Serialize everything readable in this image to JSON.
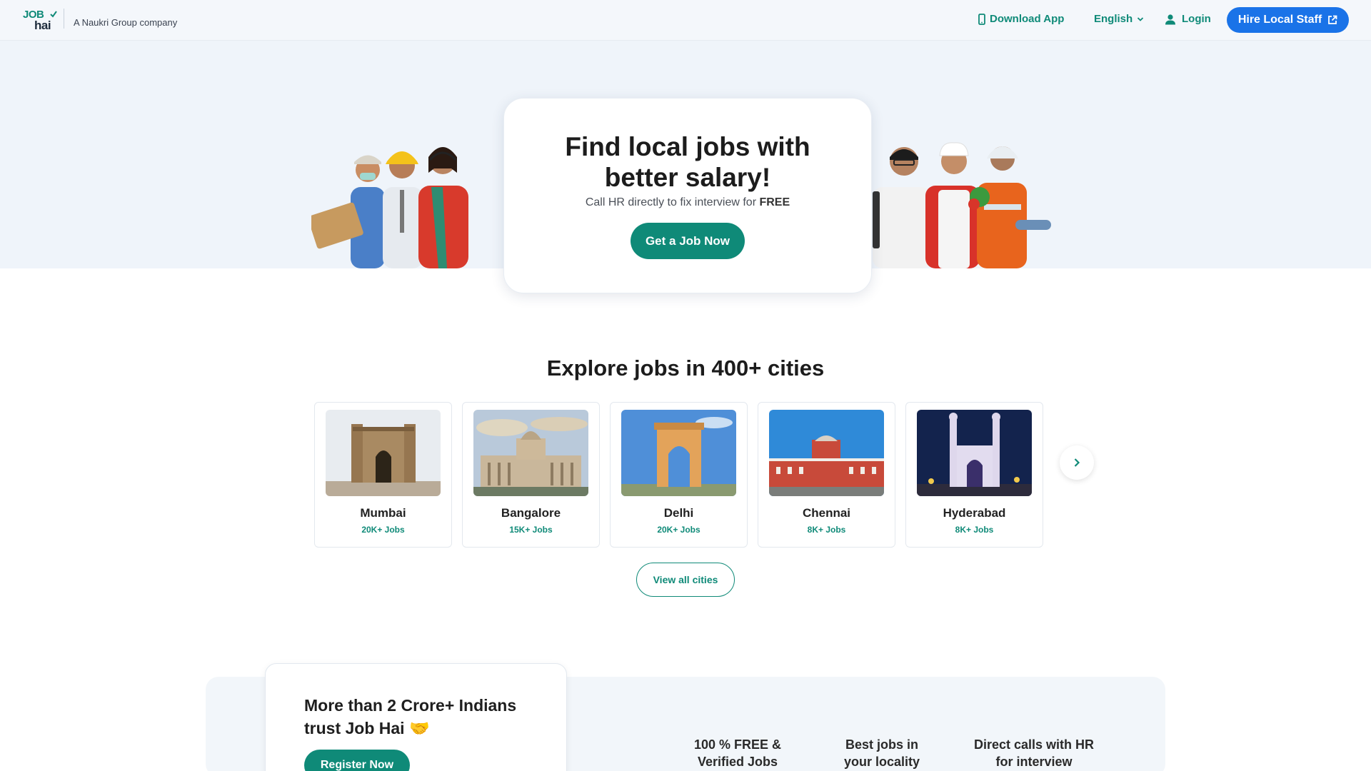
{
  "header": {
    "logo_top": "JOB",
    "logo_bottom": "hai",
    "tagline": "A Naukri Group company",
    "download_label": "Download App",
    "language_label": "English",
    "login_label": "Login",
    "hire_label": "Hire Local Staff"
  },
  "hero": {
    "title_line1": "Find local jobs with",
    "title_line2": "better salary!",
    "subtitle_prefix": "Call HR directly to fix interview for ",
    "subtitle_bold": "FREE",
    "cta_label": "Get a Job Now"
  },
  "cities": {
    "heading": "Explore jobs in 400+ cities",
    "items": [
      {
        "name": "Mumbai",
        "jobs": "20K+ Jobs"
      },
      {
        "name": "Bangalore",
        "jobs": "15K+ Jobs"
      },
      {
        "name": "Delhi",
        "jobs": "20K+ Jobs"
      },
      {
        "name": "Chennai",
        "jobs": "8K+ Jobs"
      },
      {
        "name": "Hyderabad",
        "jobs": "8K+ Jobs"
      }
    ],
    "view_all_label": "View all cities"
  },
  "trust": {
    "title": "More than 2 Crore+ Indians trust Job Hai 🤝",
    "register_label": "Register Now",
    "features": [
      {
        "line1": "100 % FREE &",
        "line2": "Verified Jobs"
      },
      {
        "line1": "Best jobs in",
        "line2": "your locality"
      },
      {
        "line1": "Direct calls with HR",
        "line2": "for interview"
      }
    ]
  },
  "colors": {
    "brand_green": "#0f8a78",
    "hire_blue": "#1a73e8",
    "hero_bg": "#eff4fa"
  },
  "icons": [
    "phone-icon",
    "chevron-down-icon",
    "user-icon",
    "external-link-icon",
    "chevron-right-icon"
  ]
}
